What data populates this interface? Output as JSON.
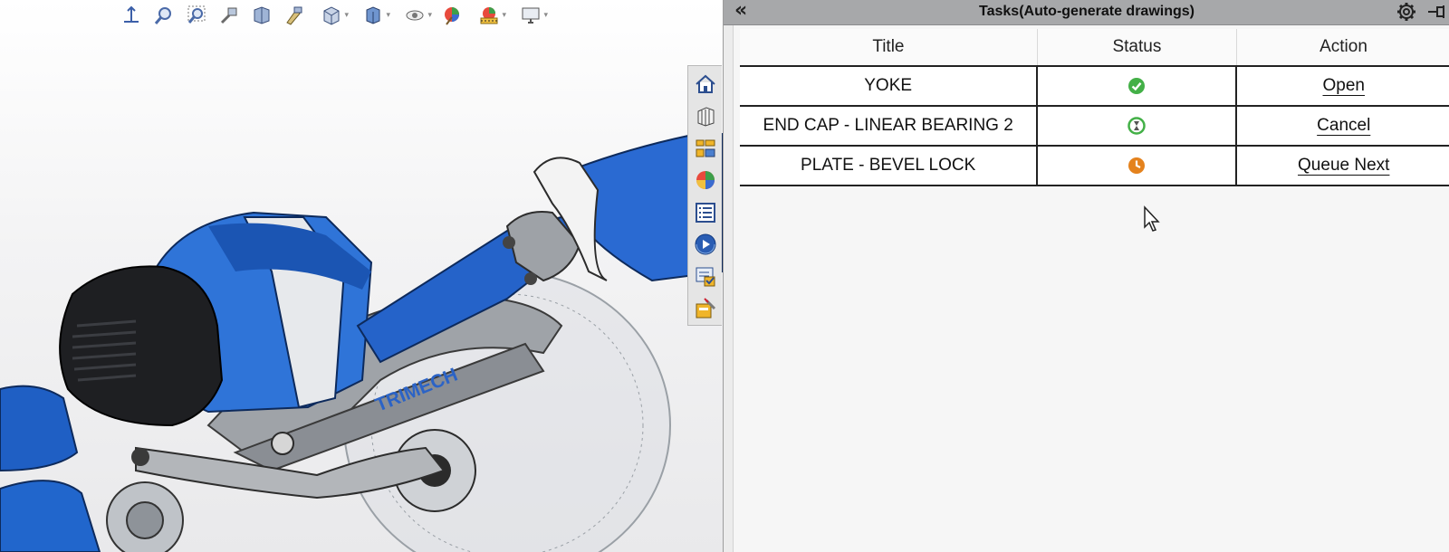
{
  "viewport": {
    "hud_toolbar": [
      {
        "icon": "view-orientation-icon"
      },
      {
        "icon": "zoom-to-fit-icon"
      },
      {
        "icon": "zoom-to-area-icon"
      },
      {
        "icon": "previous-view-icon"
      },
      {
        "icon": "section-view-icon"
      },
      {
        "icon": "dynamic-annotation-icon"
      },
      {
        "icon": "view-orientation-dropdown-icon"
      },
      {
        "icon": "display-style-dropdown-icon"
      },
      {
        "icon": "hide-show-items-icon"
      },
      {
        "icon": "edit-appearance-icon"
      },
      {
        "icon": "apply-scene-icon"
      },
      {
        "icon": "view-settings-icon"
      }
    ],
    "model_logo_text": "TRIMECH",
    "task_tabs": [
      {
        "icon": "home-icon"
      },
      {
        "icon": "design-library-icon"
      },
      {
        "icon": "file-explorer-icon"
      },
      {
        "icon": "appearances-icon"
      },
      {
        "icon": "custom-properties-icon"
      },
      {
        "icon": "motion-icon"
      },
      {
        "icon": "tasks-icon"
      },
      {
        "icon": "drawing-tasks-icon"
      }
    ]
  },
  "task_pane": {
    "title": "Tasks(Auto-generate drawings)",
    "collapse_glyph": "«",
    "columns": {
      "title": "Title",
      "status": "Status",
      "action": "Action"
    },
    "rows": [
      {
        "title": "YOKE",
        "status": "completed",
        "status_icon": "check-circle-icon",
        "status_color": "#43b047",
        "action": "Open"
      },
      {
        "title": "END CAP - LINEAR BEARING 2",
        "status": "in-progress",
        "status_icon": "hourglass-icon",
        "status_color": "#43b047",
        "action": "Cancel"
      },
      {
        "title": "PLATE - BEVEL LOCK",
        "status": "queued",
        "status_icon": "clock-icon",
        "status_color": "#e4821d",
        "action": "Queue Next"
      }
    ]
  }
}
